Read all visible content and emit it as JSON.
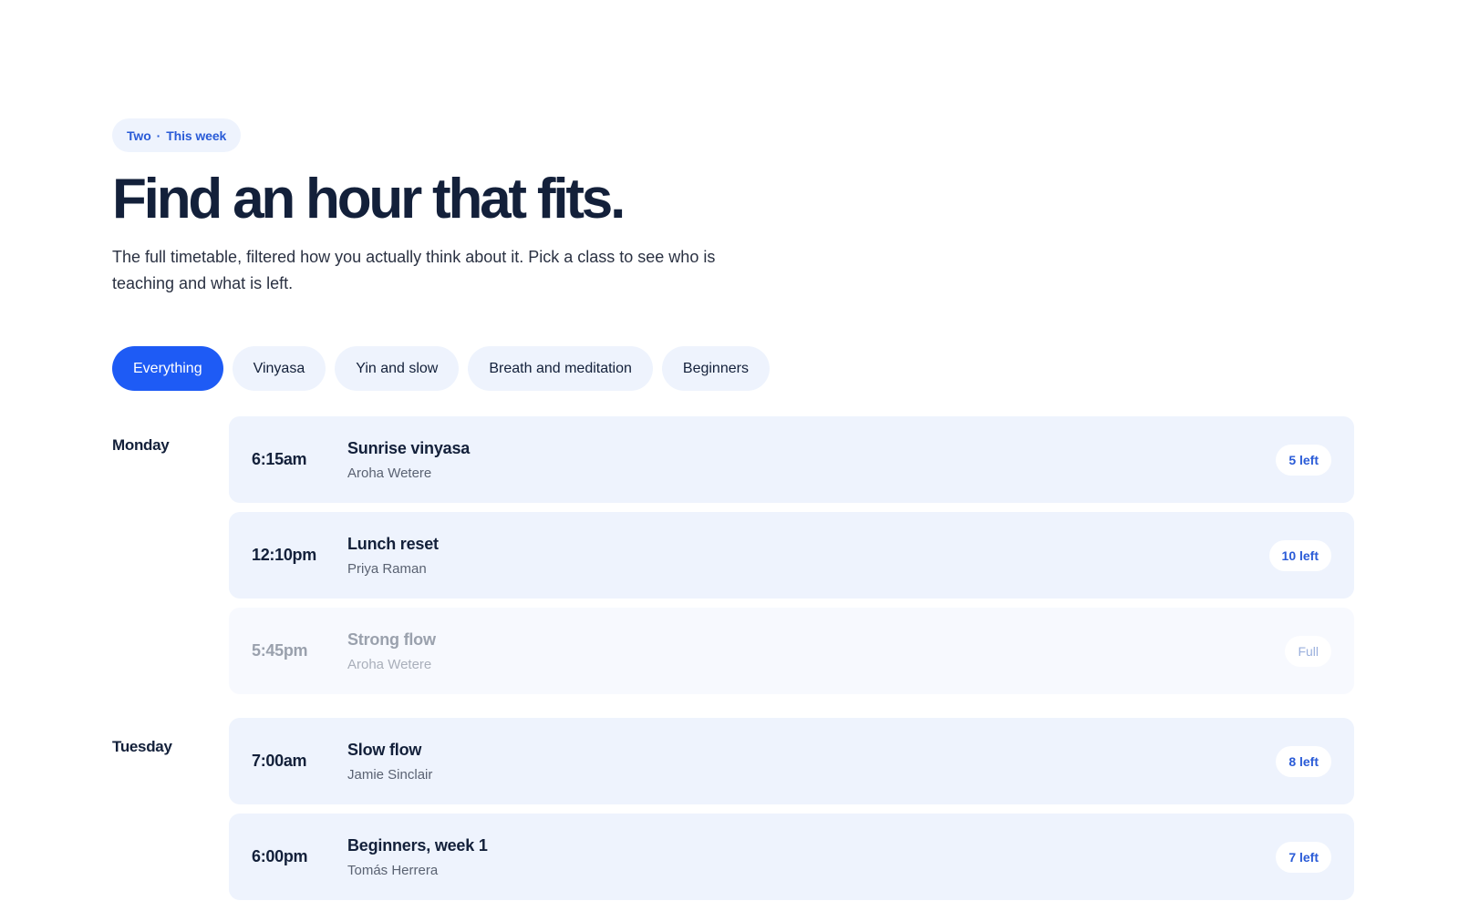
{
  "header": {
    "eyebrow_left": "Two",
    "eyebrow_sep": "·",
    "eyebrow_right": "This week",
    "title": "Find an hour that fits.",
    "subtitle": "The full timetable, filtered how you actually think about it. Pick a class to see who is teaching and what is left."
  },
  "filters": [
    "Everything",
    "Vinyasa",
    "Yin and slow",
    "Breath and meditation",
    "Beginners"
  ],
  "active_filter": "Everything",
  "days": [
    {
      "name": "Monday",
      "sessions": [
        {
          "time": "6:15am",
          "name": "Sunrise vinyasa",
          "teacher": "Aroha Wetere",
          "availability": "5 left",
          "full": false
        },
        {
          "time": "12:10pm",
          "name": "Lunch reset",
          "teacher": "Priya Raman",
          "availability": "10 left",
          "full": false
        },
        {
          "time": "5:45pm",
          "name": "Strong flow",
          "teacher": "Aroha Wetere",
          "availability": "Full",
          "full": true
        }
      ]
    },
    {
      "name": "Tuesday",
      "sessions": [
        {
          "time": "7:00am",
          "name": "Slow flow",
          "teacher": "Jamie Sinclair",
          "availability": "8 left",
          "full": false
        },
        {
          "time": "6:00pm",
          "name": "Beginners, week 1",
          "teacher": "Tomás Herrera",
          "availability": "7 left",
          "full": false
        }
      ]
    }
  ],
  "colors": {
    "accent": "#1e5bf5",
    "chip_bg": "#eef3fd",
    "badge_text": "#2a5bd7",
    "heading": "#13203a"
  }
}
